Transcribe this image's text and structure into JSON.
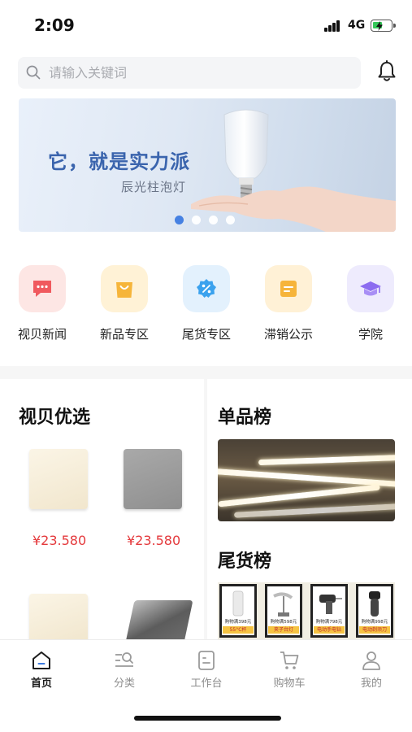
{
  "status_bar": {
    "time": "2:09",
    "network": "4G"
  },
  "search": {
    "placeholder": "请输入关键词"
  },
  "banner": {
    "headline": "它，就是实力派",
    "subline": "辰光柱泡灯",
    "dot_count": 4,
    "active_dot": 0
  },
  "categories": [
    {
      "label": "视贝新闻",
      "icon": "chat-bubble-icon",
      "bg": "#fde6e4",
      "fg": "#f0595e"
    },
    {
      "label": "新品专区",
      "icon": "shopping-bag-icon",
      "bg": "#fff2d6",
      "fg": "#f6b53a"
    },
    {
      "label": "尾货专区",
      "icon": "discount-badge-icon",
      "bg": "#e3f1fd",
      "fg": "#3ba2ee"
    },
    {
      "label": "滞销公示",
      "icon": "document-icon",
      "bg": "#fff1d6",
      "fg": "#f6b43a"
    },
    {
      "label": "学院",
      "icon": "graduation-cap-icon",
      "bg": "#eeebfd",
      "fg": "#8c6cf0"
    }
  ],
  "featured": {
    "title": "视贝优选",
    "products": [
      {
        "price": "¥23.580"
      },
      {
        "price": "¥23.580"
      }
    ]
  },
  "ranking": {
    "title": "单品榜"
  },
  "clearance": {
    "title": "尾货榜",
    "items": [
      {
        "promo": "购物满398元",
        "tag": "55°C杯"
      },
      {
        "promo": "购物满598元",
        "tag": "夹子台灯"
      },
      {
        "promo": "购物满798元",
        "tag": "电动手电钻"
      },
      {
        "promo": "购物满998元",
        "tag": "电动剃须刀"
      }
    ]
  },
  "tabbar": {
    "tabs": [
      {
        "label": "首页",
        "icon": "home-icon",
        "active": true
      },
      {
        "label": "分类",
        "icon": "category-search-icon",
        "active": false
      },
      {
        "label": "工作台",
        "icon": "workbench-icon",
        "active": false
      },
      {
        "label": "购物车",
        "icon": "cart-icon",
        "active": false
      },
      {
        "label": "我的",
        "icon": "profile-icon",
        "active": false
      }
    ]
  },
  "colors": {
    "price": "#e4393c",
    "banner_text": "#3a64ad",
    "active_dot": "#3d7be0"
  }
}
